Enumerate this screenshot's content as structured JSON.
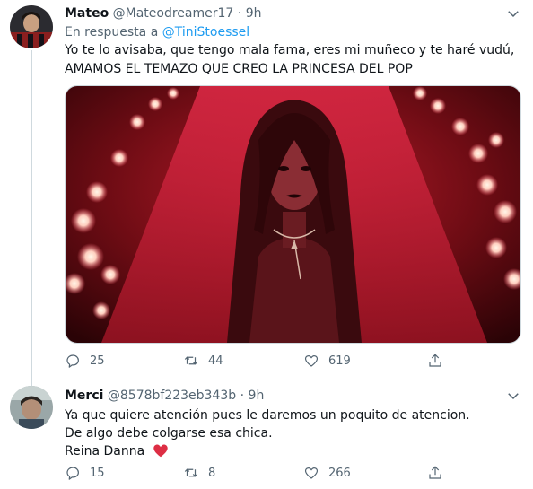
{
  "tweets": [
    {
      "name": "Mateo",
      "handle": "@Mateodreamer17",
      "time": "9h",
      "reply_prefix": "En respuesta a",
      "reply_mention": "@TiniStoessel",
      "text_lines": [
        "Yo te lo avisaba, que tengo mala fama, eres mi muñeco y te haré vudú,",
        "AMAMOS EL TEMAZO QUE CREO LA PRINCESA DEL POP"
      ],
      "counts": {
        "replies": "25",
        "retweets": "44",
        "likes": "619"
      }
    },
    {
      "name": "Merci",
      "handle": "@8578bf223eb343b",
      "time": "9h",
      "text_lines": [
        "Ya que quiere atención pues le daremos un poquito de atencion.",
        "De algo debe colgarse esa chica.",
        "Reina Danna"
      ],
      "emoji": "red-heart",
      "counts": {
        "replies": "15",
        "retweets": "8",
        "likes": "266"
      }
    }
  ],
  "icons": {
    "reply": "reply-icon",
    "retweet": "retweet-icon",
    "like": "like-icon",
    "share": "share-icon",
    "caret": "chevron-down-icon"
  },
  "colors": {
    "text": "#0f1419",
    "secondary": "#536471",
    "link": "#1d9bf0",
    "separator": "#e6ecf0",
    "heart": "#e0245e"
  }
}
